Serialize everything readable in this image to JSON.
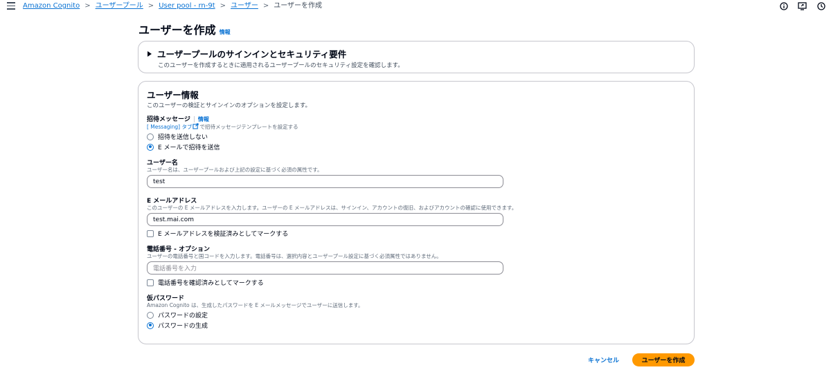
{
  "breadcrumb": {
    "items": [
      "Amazon Cognito",
      "ユーザープール",
      "User pool - rn-9t",
      "ユーザー"
    ],
    "current": "ユーザーを作成",
    "separator": ">"
  },
  "header": {
    "title": "ユーザーを作成",
    "info": "情報"
  },
  "security_panel": {
    "title": "ユーザープールのサインインとセキュリティ要件",
    "description": "このユーザーを作成するときに適用されるユーザープールのセキュリティ設定を確認します。"
  },
  "user_info": {
    "title": "ユーザー情報",
    "description": "このユーザーの検証とサインインのオプションを設定します。",
    "invitation": {
      "label": "招待メッセージ",
      "info": "情報",
      "desc_link": "[ Messaging] タブ",
      "desc_rest": "で招待メッセージテンプレートを設定する",
      "options": [
        "招待を送信しない",
        "E メールで招待を送信"
      ],
      "selected": 1
    },
    "username": {
      "label": "ユーザー名",
      "description": "ユーザー名は、ユーザープールおよび上記の設定に基づく必須の属性です。",
      "value": "test"
    },
    "email": {
      "label": "E メールアドレス",
      "description": "このユーザーの E メールアドレスを入力します。ユーザーの E メールアドレスは、サインイン、アカウントの復旧、およびアカウントの確認に使用できます。",
      "value": "test.mai.com",
      "verify_label": "E メールアドレスを検証済みとしてマークする"
    },
    "phone": {
      "label": "電話番号 - オプション",
      "description": "ユーザーの電話番号と国コードを入力します。電話番号は、選択内容とユーザープール設定に基づく必須属性ではありません。",
      "placeholder": "電話番号を入力",
      "verify_label": "電話番号を確認済みとしてマークする"
    },
    "password": {
      "label": "仮パスワード",
      "description": "Amazon Cognito は、生成したパスワードを E メールメッセージでユーザーに送信します。",
      "options": [
        "パスワードの設定",
        "パスワードの生成"
      ],
      "selected": 1
    }
  },
  "footer": {
    "cancel": "キャンセル",
    "submit": "ユーザーを作成"
  },
  "colors": {
    "link": "#0972d3",
    "primary": "#ff9900"
  }
}
